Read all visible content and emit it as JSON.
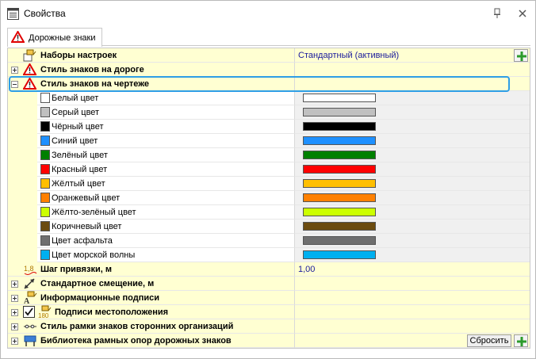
{
  "window": {
    "title": "Свойства",
    "title_icon": "properties-icon",
    "pin_icon": "pin-icon",
    "close_icon": "close-icon"
  },
  "tabs": [
    {
      "label": "Дорожные знаки",
      "icon": "road-sign-warning-icon",
      "active": true
    }
  ],
  "grid": {
    "settings_sets": {
      "label": "Наборы настроек",
      "value": "Стандартный (активный)",
      "add_icon": "add-icon"
    },
    "road_style": {
      "label": "Стиль знаков на дороге"
    },
    "drawing_style": {
      "label": "Стиль знаков на чертеже",
      "colors": [
        {
          "label": "Белый цвет",
          "color": "#ffffff"
        },
        {
          "label": "Серый цвет",
          "color": "#c0c0c0"
        },
        {
          "label": "Чёрный цвет",
          "color": "#000000"
        },
        {
          "label": "Синий цвет",
          "color": "#1e90ff"
        },
        {
          "label": "Зелёный цвет",
          "color": "#008000"
        },
        {
          "label": "Красный цвет",
          "color": "#ff0000"
        },
        {
          "label": "Жёлтый цвет",
          "color": "#ffbf00"
        },
        {
          "label": "Оранжевый цвет",
          "color": "#ff8000"
        },
        {
          "label": "Жёлто-зелёный цвет",
          "color": "#ccff00"
        },
        {
          "label": "Коричневый цвет",
          "color": "#6b4b0f"
        },
        {
          "label": "Цвет асфальта",
          "color": "#6f6f6f"
        },
        {
          "label": "Цвет морской волны",
          "color": "#00b0f0"
        }
      ]
    },
    "snap_step": {
      "label": "Шаг привязки, м",
      "value": "1,00"
    },
    "std_offset": {
      "label": "Стандартное смещение, м"
    },
    "info_captions": {
      "label": "Информационные подписи"
    },
    "location_captions": {
      "label": "Подписи местоположения",
      "checked": true
    },
    "third_party_frame": {
      "label": "Стиль рамки знаков сторонних организаций"
    },
    "frame_library": {
      "label": "Библиотека рамных опор дорожных знаков",
      "reset_label": "Сбросить"
    }
  }
}
